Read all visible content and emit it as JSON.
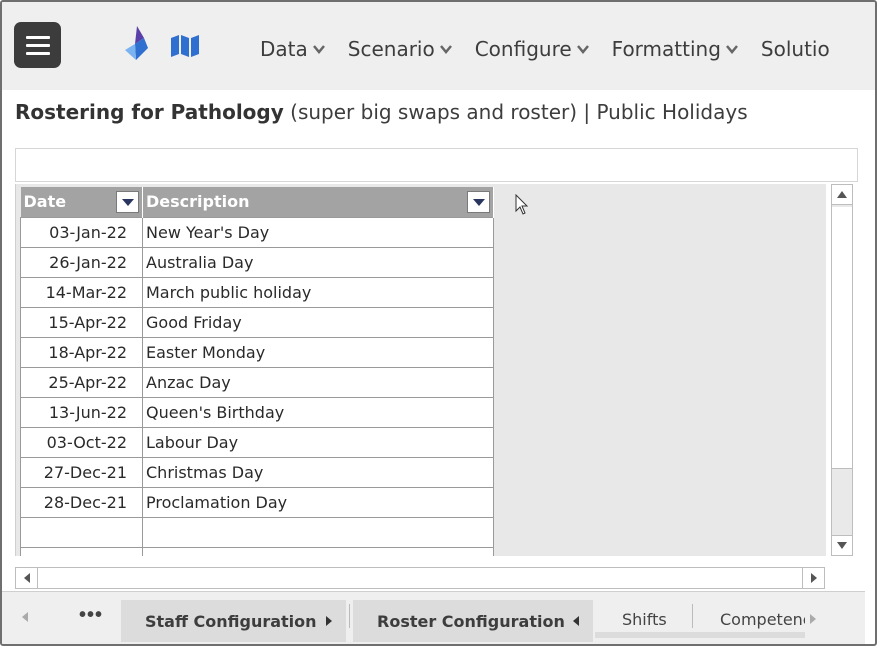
{
  "header": {
    "menu_items": [
      {
        "label": "Data"
      },
      {
        "label": "Scenario"
      },
      {
        "label": "Configure"
      },
      {
        "label": "Formatting"
      },
      {
        "label": "Solutio"
      }
    ]
  },
  "page": {
    "title_bold": "Rostering for Pathology",
    "title_rest": " (super big swaps and roster) | Public Holidays"
  },
  "editbar": {
    "value": ""
  },
  "table": {
    "columns": [
      "Date",
      "Description"
    ],
    "rows": [
      {
        "date": "03-Jan-22",
        "desc": "New Year's Day"
      },
      {
        "date": "26-Jan-22",
        "desc": "Australia Day"
      },
      {
        "date": "14-Mar-22",
        "desc": "March public holiday"
      },
      {
        "date": "15-Apr-22",
        "desc": "Good Friday"
      },
      {
        "date": "18-Apr-22",
        "desc": "Easter Monday"
      },
      {
        "date": "25-Apr-22",
        "desc": "Anzac Day"
      },
      {
        "date": "13-Jun-22",
        "desc": "Queen's Birthday"
      },
      {
        "date": "03-Oct-22",
        "desc": "Labour Day"
      },
      {
        "date": "27-Dec-21",
        "desc": "Christmas Day"
      },
      {
        "date": "28-Dec-21",
        "desc": "Proclamation Day"
      },
      {
        "date": "",
        "desc": ""
      },
      {
        "date": "",
        "desc": ""
      }
    ]
  },
  "tabs": {
    "more": "•••",
    "staff": "Staff Configuration",
    "roster": "Roster Configuration",
    "shifts": "Shifts",
    "competencies": "Competenc"
  },
  "colors": {
    "topbar_bg": "#efefef",
    "hamburger_bg": "#3c3c3c",
    "header_bg": "#a3a3a3",
    "logo_blue": "#2f6fd0",
    "logo_purple": "#5a3fa8"
  }
}
